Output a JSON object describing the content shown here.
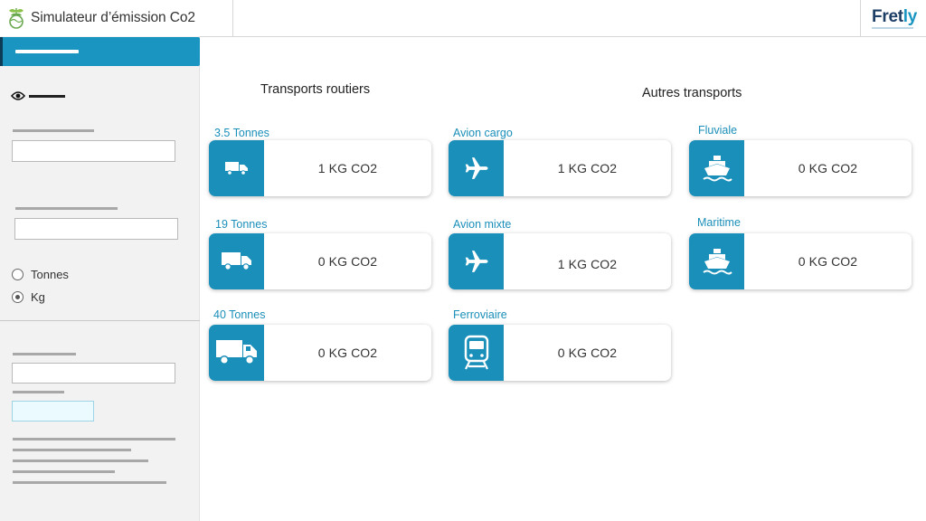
{
  "app": {
    "title": "Simulateur d’émission Co2",
    "brand": {
      "name_main": "Fret",
      "name_accent": "ly"
    }
  },
  "sidebar": {
    "units": [
      {
        "label": "Tonnes",
        "checked": false
      },
      {
        "label": "Kg",
        "checked": true
      }
    ]
  },
  "sections": {
    "road": "Transports routiers",
    "other": "Autres transports"
  },
  "cards": [
    {
      "label": "3.5 Tonnes",
      "value": "1 KG CO2",
      "icon": "small-truck-icon"
    },
    {
      "label": "19 Tonnes",
      "value": "0 KG CO2",
      "icon": "truck-icon"
    },
    {
      "label": "40 Tonnes",
      "value": "0 KG CO2",
      "icon": "large-truck-icon"
    },
    {
      "label": "Avion cargo",
      "value": "1 KG CO2",
      "icon": "airplane-icon"
    },
    {
      "label": "Avion mixte",
      "value": "1 KG CO2",
      "icon": "airplane-icon"
    },
    {
      "label": "Ferroviaire",
      "value": "0 KG CO2",
      "icon": "train-icon"
    },
    {
      "label": "Fluviale",
      "value": "0 KG CO2",
      "icon": "ship-icon"
    },
    {
      "label": "Maritime",
      "value": "0 KG CO2",
      "icon": "ship-icon"
    }
  ],
  "colors": {
    "accent": "#1a8fb9",
    "brand_dark": "#1d3f66",
    "sidebar_bg": "#f2f2f2"
  }
}
